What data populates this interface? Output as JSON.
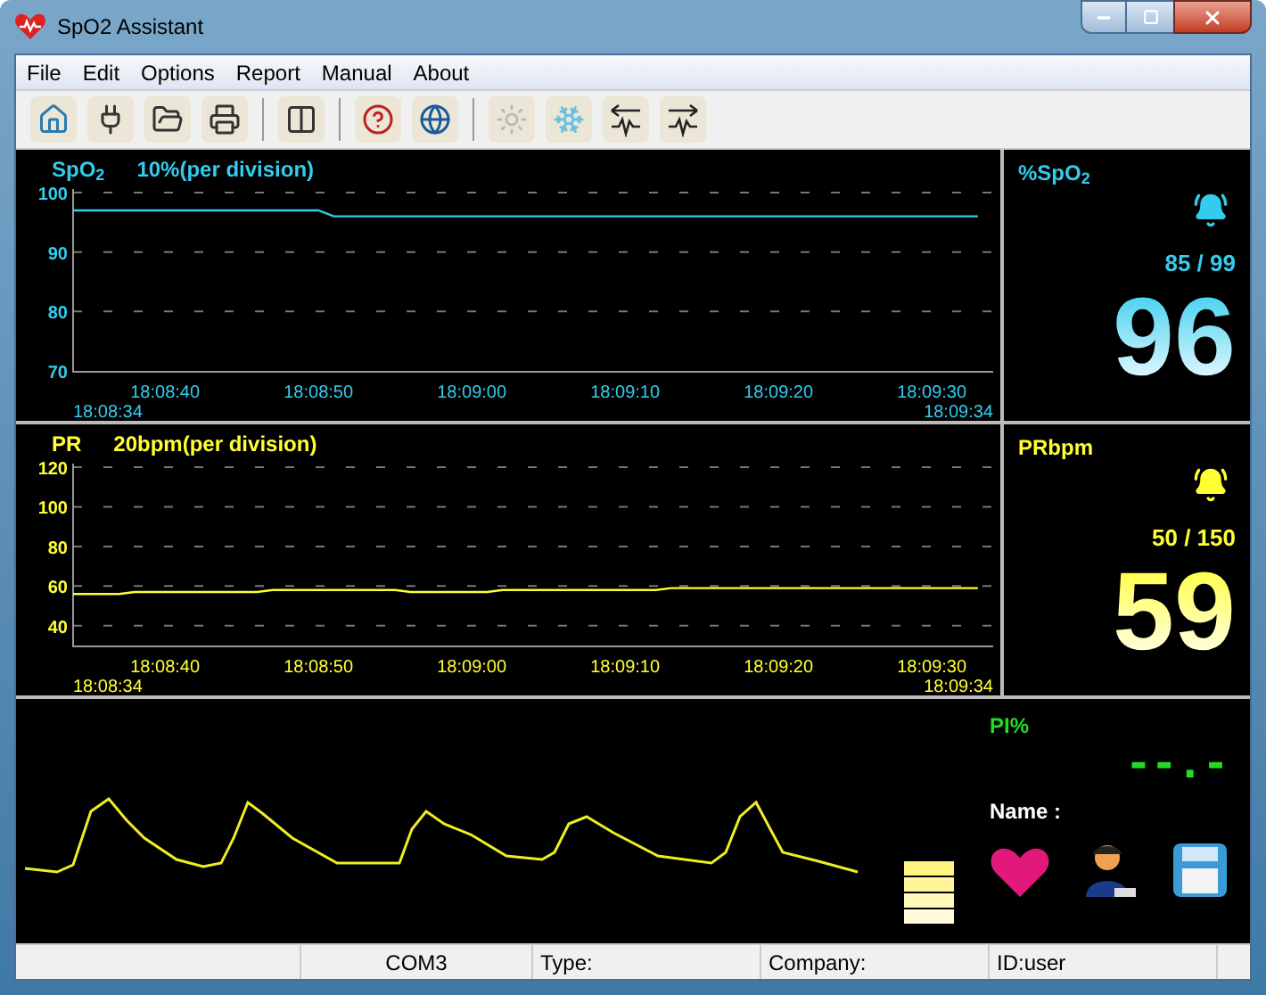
{
  "window": {
    "title": "SpO2 Assistant"
  },
  "menu": [
    "File",
    "Edit",
    "Options",
    "Report",
    "Manual",
    "About"
  ],
  "trends": [
    {
      "label": "SpO$_{2}$",
      "scale": "10%(per division)",
      "start_time": "18:08:34",
      "end_time": "18:09:34",
      "chart_data": {
        "type": "line",
        "categories": [
          null,
          null,
          null,
          null,
          null,
          null,
          "18:08:40",
          null,
          null,
          null,
          null,
          null,
          null,
          null,
          null,
          null,
          "18:08:50",
          null,
          null,
          null,
          null,
          null,
          null,
          null,
          null,
          null,
          "18:09:00",
          null,
          null,
          null,
          null,
          null,
          null,
          null,
          null,
          null,
          "18:09:10",
          null,
          null,
          null,
          null,
          null,
          null,
          null,
          null,
          null,
          "18:09:20",
          null,
          null,
          null,
          null,
          null,
          null,
          null,
          null,
          null,
          "18:09:30",
          null,
          null,
          null,
          null
        ],
        "series": [
          {
            "color": "#33ccee",
            "values": [
              97,
              97,
              97,
              97,
              97,
              97,
              97,
              97,
              97,
              97,
              97,
              97,
              97,
              97,
              97,
              97,
              97,
              96,
              96,
              96,
              96,
              96,
              96,
              96,
              96,
              96,
              96,
              96,
              96,
              96,
              96,
              96,
              96,
              96,
              96,
              96,
              96,
              96,
              96,
              96,
              96,
              96,
              96,
              96,
              96,
              96,
              96,
              96,
              96,
              96,
              96,
              96,
              96,
              96,
              96,
              96,
              96,
              96,
              96,
              96,
              null
            ]
          }
        ],
        "ylim": [
          70,
          100
        ],
        "yticks": [
          70,
          80,
          90,
          100
        ],
        "grid": true
      }
    },
    {
      "label": "PR",
      "scale": "20bpm(per division)",
      "start_time": "18:08:34",
      "end_time": "18:09:34",
      "chart_data": {
        "type": "line",
        "categories": [
          null,
          null,
          null,
          null,
          null,
          null,
          "18:08:40",
          null,
          null,
          null,
          null,
          null,
          null,
          null,
          null,
          null,
          "18:08:50",
          null,
          null,
          null,
          null,
          null,
          null,
          null,
          null,
          null,
          "18:09:00",
          null,
          null,
          null,
          null,
          null,
          null,
          null,
          null,
          null,
          "18:09:10",
          null,
          null,
          null,
          null,
          null,
          null,
          null,
          null,
          null,
          "18:09:20",
          null,
          null,
          null,
          null,
          null,
          null,
          null,
          null,
          null,
          "18:09:30",
          null,
          null,
          null,
          null
        ],
        "series": [
          {
            "color": "#ffff33",
            "values": [
              56,
              56,
              56,
              56,
              57,
              57,
              57,
              57,
              57,
              57,
              57,
              57,
              57,
              58,
              58,
              58,
              58,
              58,
              58,
              58,
              58,
              58,
              57,
              57,
              57,
              57,
              57,
              57,
              58,
              58,
              58,
              58,
              58,
              58,
              58,
              58,
              58,
              58,
              58,
              59,
              59,
              59,
              59,
              59,
              59,
              59,
              59,
              59,
              59,
              59,
              59,
              59,
              59,
              59,
              59,
              59,
              59,
              59,
              59,
              59,
              null
            ]
          }
        ],
        "ylim": [
          30,
          120
        ],
        "yticks": [
          40,
          60,
          80,
          100,
          120
        ],
        "grid": true
      }
    }
  ],
  "numerics": [
    {
      "label": "%SpO$_{2}$",
      "limits": "85 / 99",
      "value": "96",
      "color": "#33ccee"
    },
    {
      "label": "PRbpm",
      "limits": "50 / 150",
      "value": "59",
      "color": "#ffff33"
    }
  ],
  "pi": {
    "label": "PI%",
    "value": "--.-"
  },
  "patient": {
    "name_label": "Name :"
  },
  "status_bar": [
    "COM3",
    "Type:",
    "Company:",
    "ID:user"
  ]
}
